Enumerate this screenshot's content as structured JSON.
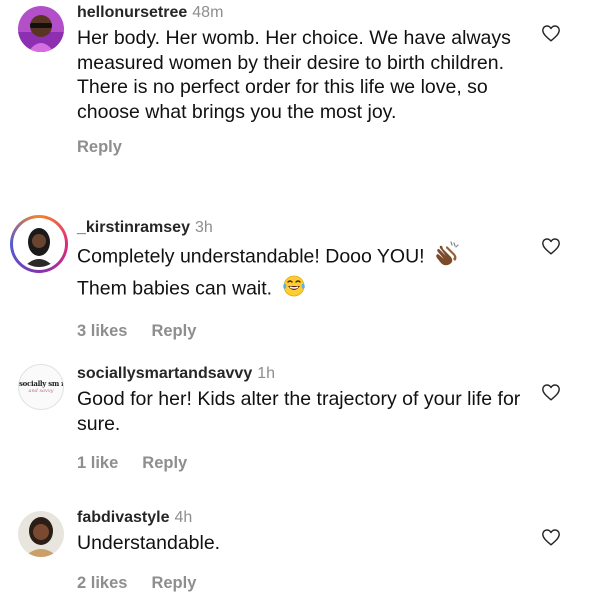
{
  "comments": [
    {
      "username": "hellonursetree",
      "time": "48m",
      "text": "Her body. Her womb. Her choice. We have always measured women by their desire to birth children. There is no perfect order for this life we love, so choose what brings you the most joy.",
      "likes": "",
      "reply_label": "Reply"
    },
    {
      "username": "_kirstinramsey",
      "time": "3h",
      "text_line1": "Completely understandable! Dooo YOU!",
      "text_line2": "Them babies can wait.",
      "likes": "3 likes",
      "reply_label": "Reply",
      "emojis": [
        "clapping-hands-emoji",
        "laughing-tears-emoji"
      ]
    },
    {
      "username": "sociallysmartandsavvy",
      "time": "1h",
      "text": "Good for her! Kids alter the trajectory of your life for sure.",
      "likes": "1 like",
      "reply_label": "Reply",
      "avatar_text": "socially sm rt",
      "avatar_subtext": "and savvy"
    },
    {
      "username": "fabdivastyle",
      "time": "4h",
      "text": "Understandable.",
      "likes": "2 likes",
      "reply_label": "Reply"
    }
  ],
  "colors": {
    "username": "#262626",
    "meta": "#8e8e8e",
    "text": "#111111",
    "story_ring": "#dd2a7b"
  },
  "icons": {
    "like": "heart-outline-icon"
  }
}
